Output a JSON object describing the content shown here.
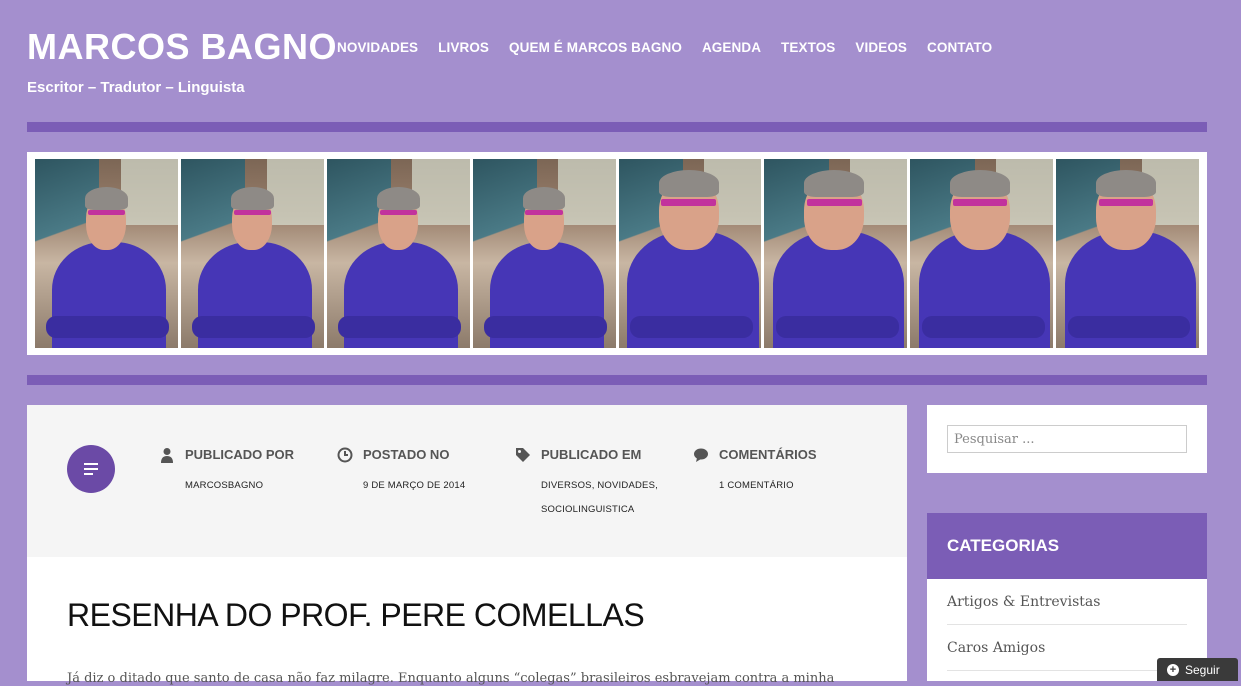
{
  "site": {
    "title": "MARCOS BAGNO",
    "tagline": "Escritor – Tradutor – Linguista"
  },
  "nav": {
    "items": [
      {
        "label": "NOVIDADES"
      },
      {
        "label": "LIVROS"
      },
      {
        "label": "QUEM É MARCOS BAGNO"
      },
      {
        "label": "AGENDA"
      },
      {
        "label": "TEXTOS"
      },
      {
        "label": "VIDEOS"
      },
      {
        "label": "CONTATO"
      }
    ]
  },
  "post": {
    "meta": {
      "author_label": "PUBLICADO POR",
      "author": "MARCOSBAGNO",
      "date_label": "POSTADO NO",
      "date": "9 DE MARÇO DE 2014",
      "categories_label": "PUBLICADO EM",
      "categories_line1": "DIVERSOS, NOVIDADES,",
      "categories_line2": "SOCIOLINGUISTICA",
      "comments_label": "COMENTÁRIOS",
      "comments": "1 COMENTÁRIO"
    },
    "title": "RESENHA DO PROF. PERE COMELLAS",
    "excerpt": "Já diz o ditado que santo de casa não faz milagre. Enquanto alguns “colegas” brasileiros esbravejam contra a minha"
  },
  "sidebar": {
    "search": {
      "placeholder": "Pesquisar ..."
    },
    "categories": {
      "title": "CATEGORIAS",
      "items": [
        {
          "label": "Artigos & Entrevistas"
        },
        {
          "label": "Caros Amigos"
        }
      ]
    }
  },
  "follow": {
    "label": "Seguir"
  },
  "colors": {
    "background": "#a48fce",
    "accent": "#7b5db6",
    "badge": "#6b4aa6"
  },
  "icons": {
    "format": "standard-post-icon",
    "author": "person-icon",
    "date": "clock-icon",
    "categories": "tag-icon",
    "comments": "speech-bubble-icon",
    "follow": "plus-icon"
  }
}
